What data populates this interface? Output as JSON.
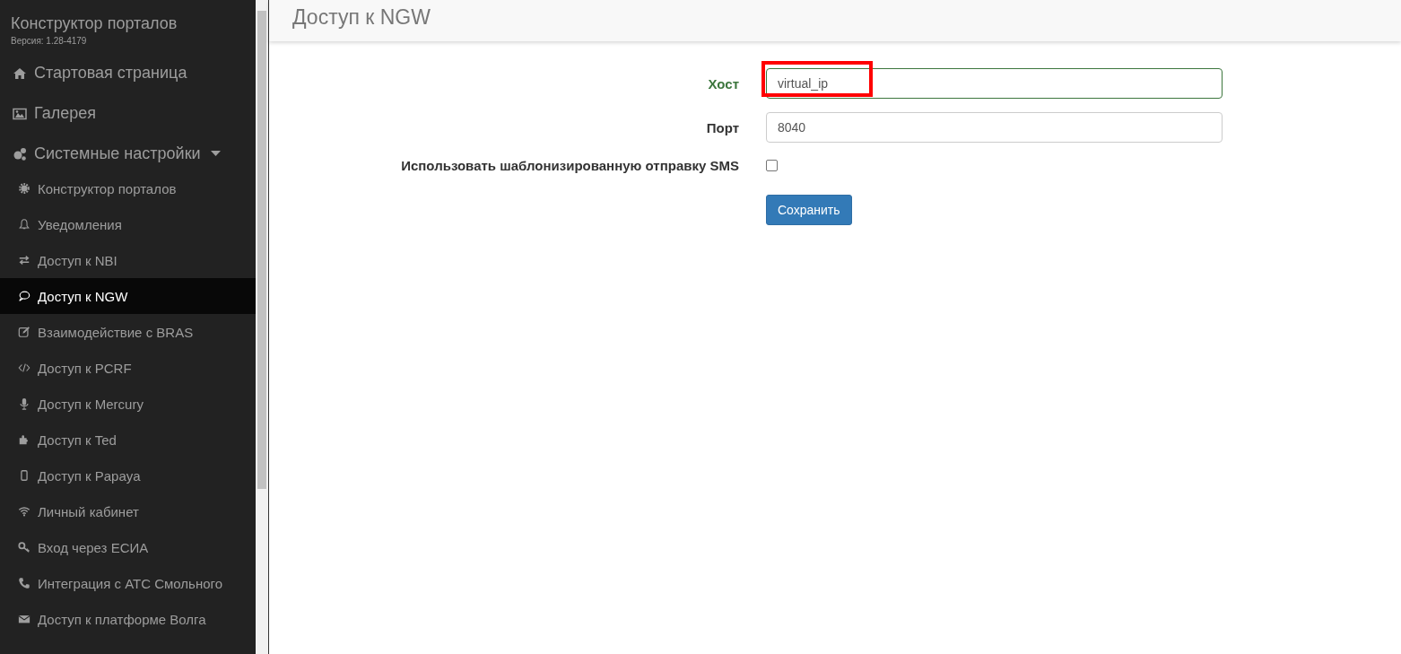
{
  "sidebar": {
    "title": "Конструктор порталов",
    "version": "Версия: 1.28-4179",
    "items": [
      {
        "label": "Стартовая страница",
        "selected": false
      },
      {
        "label": "Галерея",
        "selected": false
      },
      {
        "label": "Системные настройки",
        "selected": false,
        "expanded": true,
        "children": [
          {
            "label": "Конструктор порталов",
            "selected": false
          },
          {
            "label": "Уведомления",
            "selected": false
          },
          {
            "label": "Доступ к NBI",
            "selected": false
          },
          {
            "label": "Доступ к NGW",
            "selected": true
          },
          {
            "label": "Взаимодействие с BRAS",
            "selected": false
          },
          {
            "label": "Доступ к PCRF",
            "selected": false
          },
          {
            "label": "Доступ к Mercury",
            "selected": false
          },
          {
            "label": "Доступ к Ted",
            "selected": false
          },
          {
            "label": "Доступ к Papaya",
            "selected": false
          },
          {
            "label": "Личный кабинет",
            "selected": false
          },
          {
            "label": "Вход через ЕСИА",
            "selected": false
          },
          {
            "label": "Интеграция с АТС Смольного",
            "selected": false
          },
          {
            "label": "Доступ к платформе Волга",
            "selected": false
          }
        ]
      }
    ]
  },
  "page": {
    "title": "Доступ к NGW"
  },
  "form": {
    "fields": [
      {
        "kind": "text",
        "label": "Хост",
        "value": "virtual_ip",
        "valid": true,
        "highlighted": true
      },
      {
        "kind": "text",
        "label": "Порт",
        "value": "8040",
        "valid": false,
        "highlighted": false
      },
      {
        "kind": "checkbox",
        "label": "Использовать шаблонизированную отправку SMS",
        "checked": false
      }
    ],
    "submit": "Сохранить"
  }
}
